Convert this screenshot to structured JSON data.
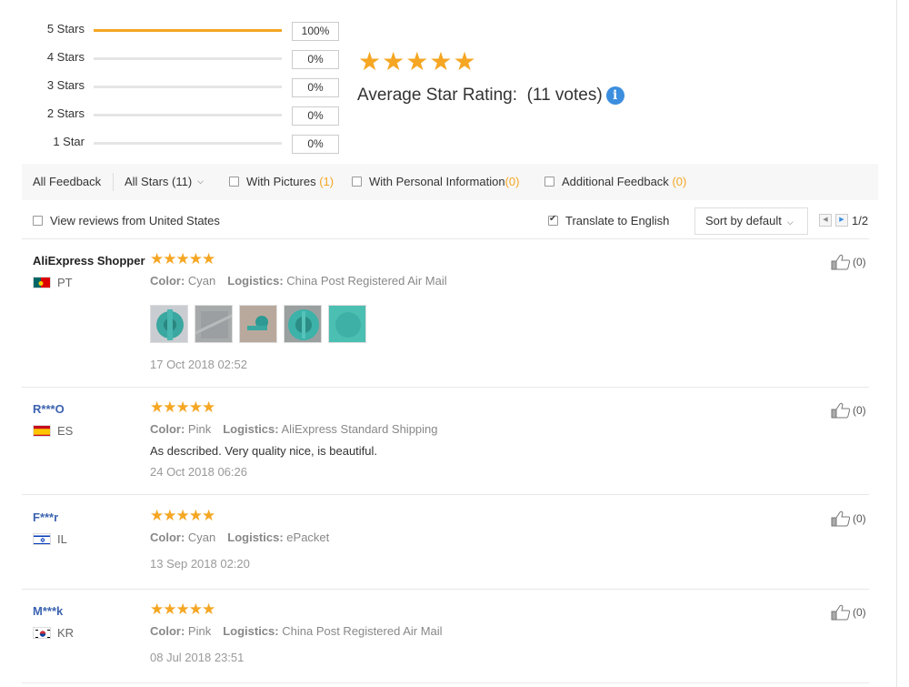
{
  "histogram": [
    {
      "label": "5 Stars",
      "pct": "100%",
      "fill": 1.0
    },
    {
      "label": "4 Stars",
      "pct": "0%",
      "fill": 0
    },
    {
      "label": "3 Stars",
      "pct": "0%",
      "fill": 0
    },
    {
      "label": "2 Stars",
      "pct": "0%",
      "fill": 0
    },
    {
      "label": "1 Star",
      "pct": "0%",
      "fill": 0
    }
  ],
  "average": {
    "stars": 5,
    "label": "Average Star Rating:",
    "votes": "(11 votes)",
    "info_icon": "info-icon"
  },
  "filters": {
    "all_feedback": "All Feedback",
    "all_stars": "All Stars (11)",
    "with_pictures": "With Pictures",
    "with_pictures_count": "(1)",
    "with_personal": "With Personal Information",
    "with_personal_count": "(0)",
    "additional": "Additional Feedback",
    "additional_count": "(0)"
  },
  "options": {
    "view_us": "View reviews from United States",
    "translate": "Translate to English",
    "translate_checked": true,
    "sort": "Sort by default",
    "page": "1/2"
  },
  "colors": {
    "star": "#f5a623",
    "link": "#3c63b0",
    "info": "#3c8ede"
  },
  "reviews": [
    {
      "name": "AliExpress Shopper",
      "country": "PT",
      "stars": 5,
      "color_label": "Color:",
      "color": "Cyan",
      "logistics_label": "Logistics:",
      "logistics": "China Post Registered Air Mail",
      "text": "",
      "date": "17 Oct 2018 02:52",
      "helpful": "(0)",
      "pictures": 5
    },
    {
      "name": "R***O",
      "country": "ES",
      "stars": 5,
      "color_label": "Color:",
      "color": "Pink",
      "logistics_label": "Logistics:",
      "logistics": "AliExpress Standard Shipping",
      "text": "As described. Very quality nice, is beautiful.",
      "date": "24 Oct 2018 06:26",
      "helpful": "(0)",
      "pictures": 0
    },
    {
      "name": "F***r",
      "country": "IL",
      "stars": 5,
      "color_label": "Color:",
      "color": "Cyan",
      "logistics_label": "Logistics:",
      "logistics": "ePacket",
      "text": "",
      "date": "13 Sep 2018 02:20",
      "helpful": "(0)",
      "pictures": 0
    },
    {
      "name": "M***k",
      "country": "KR",
      "stars": 5,
      "color_label": "Color:",
      "color": "Pink",
      "logistics_label": "Logistics:",
      "logistics": "China Post Registered Air Mail",
      "text": "",
      "date": "08 Jul 2018 23:51",
      "helpful": "(0)",
      "pictures": 0
    }
  ]
}
